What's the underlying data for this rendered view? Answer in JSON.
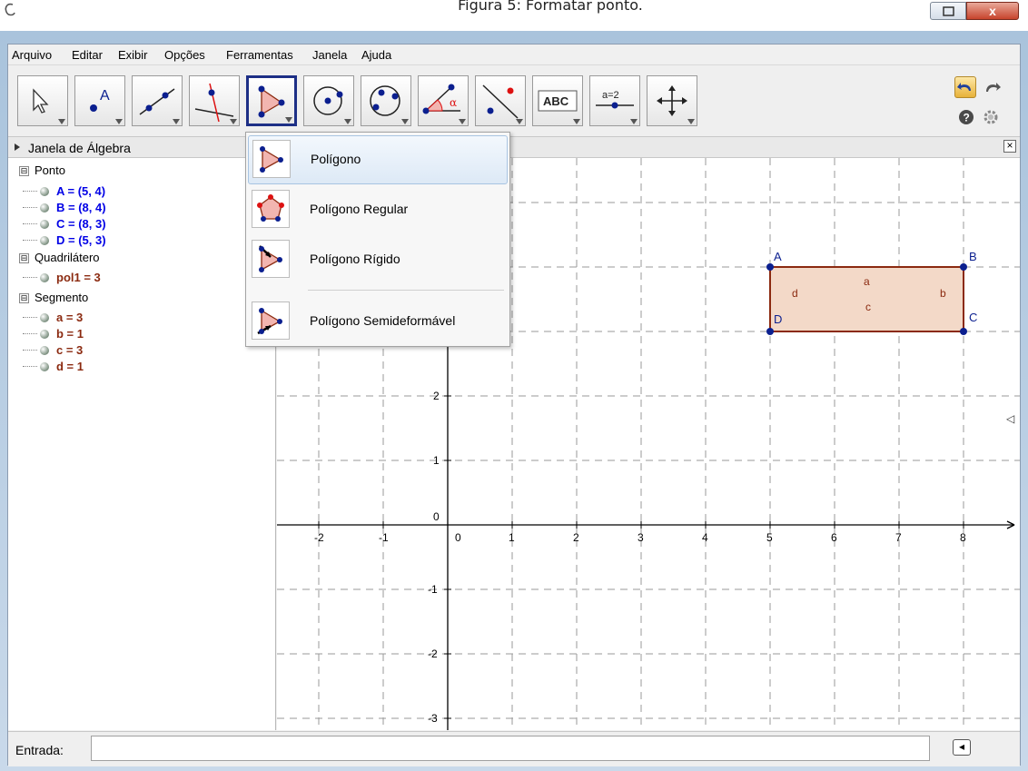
{
  "caption": "Figura 5: Formatar ponto.",
  "window_controls": {
    "close": "x"
  },
  "menu": [
    "Arquivo",
    "Editar",
    "Exibir",
    "Opções",
    "Ferramentas",
    "Janela",
    "Ajuda"
  ],
  "toolbar": {
    "tools": [
      "move-tool",
      "point-tool",
      "line-tool",
      "perpendicular-tool",
      "polygon-tool",
      "circle-tool",
      "conic-tool",
      "angle-tool",
      "reflect-tool",
      "text-tool",
      "slider-tool",
      "move-view-tool"
    ],
    "text_tool_label": "ABC",
    "slider_tool_label": "a=2",
    "polygon_marker_label": "α"
  },
  "algebra": {
    "header": "Janela de Álgebra",
    "collapse_symbol": "⊟",
    "categories": [
      {
        "name": "Ponto",
        "items": [
          "A = (5, 4)",
          "B = (8, 4)",
          "C = (8, 3)",
          "D = (5, 3)"
        ],
        "color": "#0000e6"
      },
      {
        "name": "Quadrilátero",
        "items": [
          "pol1 = 3"
        ],
        "color": "#8b2a10"
      },
      {
        "name": "Segmento",
        "items": [
          "a = 3",
          "b = 1",
          "c = 3",
          "d = 1"
        ],
        "color": "#8b2a10"
      }
    ]
  },
  "dropdown": {
    "items": [
      "Polígono",
      "Polígono Regular",
      "Polígono Rígido",
      "Polígono Semideformável"
    ],
    "highlighted": 0
  },
  "graphics": {
    "x_ticks": [
      "-2",
      "-1",
      "0",
      "1",
      "2",
      "3",
      "4",
      "5",
      "6",
      "7",
      "8"
    ],
    "y_ticks": [
      "2",
      "1",
      "0",
      "-1",
      "-2",
      "-3"
    ],
    "points": {
      "A": "A",
      "B": "B",
      "C": "C",
      "D": "D"
    },
    "segment_labels": {
      "a": "a",
      "b": "b",
      "c": "c",
      "d": "d"
    },
    "polygon_fill": "#f3d9c8",
    "polygon_stroke": "#8b2a10",
    "point_color": "#0b1f8f",
    "close_symbol": "×",
    "side_arrow": "◁"
  },
  "input": {
    "label": "Entrada:",
    "value": "",
    "help_symbol": "◂"
  }
}
